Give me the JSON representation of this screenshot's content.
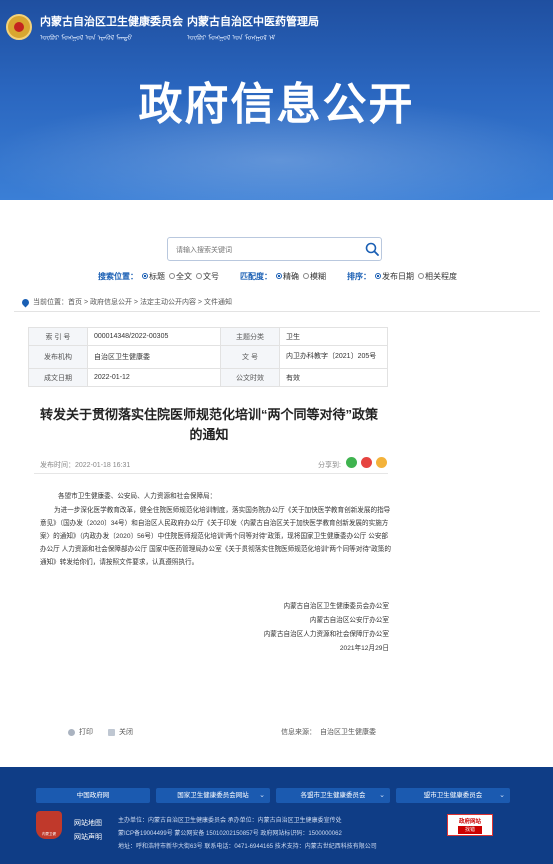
{
  "header": {
    "org1": "内蒙古自治区卫生健康委员会",
    "org2": "内蒙古自治区中医药管理局",
    "mongol1": "ᠥᠪᠥᠷ ᠮᠣᠩᠭᠣᠯ ᠤᠨ ᠡᠷᠡᠭᠦᠯ ᠮᠡᠨᠳᠦ",
    "mongol2": "ᠥᠪᠥᠷ ᠮᠣᠩᠭᠣᠯ ᠤᠨ ᠮᠣᠩᠭᠣᠯ ᠡᠮ",
    "title": "政府信息公开"
  },
  "search": {
    "placeholder": "请输入搜索关键词",
    "position_label": "搜索位置：",
    "position_options": [
      "标题",
      "全文",
      "文号"
    ],
    "match_label": "匹配度：",
    "match_options": [
      "精确",
      "模糊"
    ],
    "sort_label": "排序：",
    "sort_options": [
      "发布日期",
      "相关程度"
    ]
  },
  "breadcrumb": {
    "prefix": "当前位置：",
    "items": [
      "首页",
      "政府信息公开",
      "法定主动公开内容",
      "文件通知"
    ],
    "sep": " > "
  },
  "meta": {
    "rows": [
      {
        "k1": "索 引 号",
        "v1": "000014348/2022-00305",
        "k2": "主题分类",
        "v2": "卫生"
      },
      {
        "k1": "发布机构",
        "v1": "自治区卫生健康委",
        "k2": "文 号",
        "v2": "内卫办科教字〔2021〕205号"
      },
      {
        "k1": "成文日期",
        "v1": "2022-01-12",
        "k2": "公文时效",
        "v2": "有效"
      }
    ]
  },
  "article": {
    "title": "转发关于贯彻落实住院医师规范化培训“两个同等对待”政策的通知",
    "publish_time": "发布时间：2022-01-18 16:31",
    "share_label": "分享到:",
    "salutation": "各盟市卫生健康委、公安局、人力资源和社会保障局：",
    "body": "为进一步深化医学教育改革，健全住院医师规范化培训制度，落实国务院办公厅《关于加快医学教育创新发展的指导意见》（国办发〔2020〕34号）和自治区人民政府办公厅《关于印发〈内蒙古自治区关于加快医学教育创新发展的实施方案〉的通知》（内政办发〔2020〕56号）中住院医师规范化培训“两个同等对待”政策，现将国家卫生健康委办公厅 公安部办公厅 人力资源和社会保障部办公厅 国家中医药管理局办公室《关于贯彻落实住院医师规范化培训“两个同等对待”政策的通知》转发给你们，请按照文件要求，认真遵照执行。",
    "signatures": [
      "内蒙古自治区卫生健康委员会办公室",
      "内蒙古自治区公安厅办公室",
      "内蒙古自治区人力资源和社会保障厅办公室",
      "2021年12月29日"
    ]
  },
  "tools": {
    "print": "打印",
    "close": "关闭",
    "source": "信息来源：",
    "source_value": "自治区卫生健康委"
  },
  "footer": {
    "nav": [
      "中国政府网",
      "国家卫生健康委员会网站",
      "各盟市卫生健康委员会",
      "盟市卫生健康委员会"
    ],
    "logo_text": "内蒙卫健",
    "links": [
      "网站地图",
      "网站声明"
    ],
    "info": [
      "主办单位：内蒙古自治区卫生健康委员会    承办单位：内蒙古自治区卫生健康委宣传处",
      "蒙ICP备19004499号    蒙公网安备 15010202150857号    政府网站标识码：1500000062",
      "地址：呼和浩特市新华大街63号    联系电话：0471-6944165    技术支持：内蒙古世纪西科技有限公司"
    ],
    "badge_line1": "政府网站",
    "badge_line2": "找错"
  }
}
